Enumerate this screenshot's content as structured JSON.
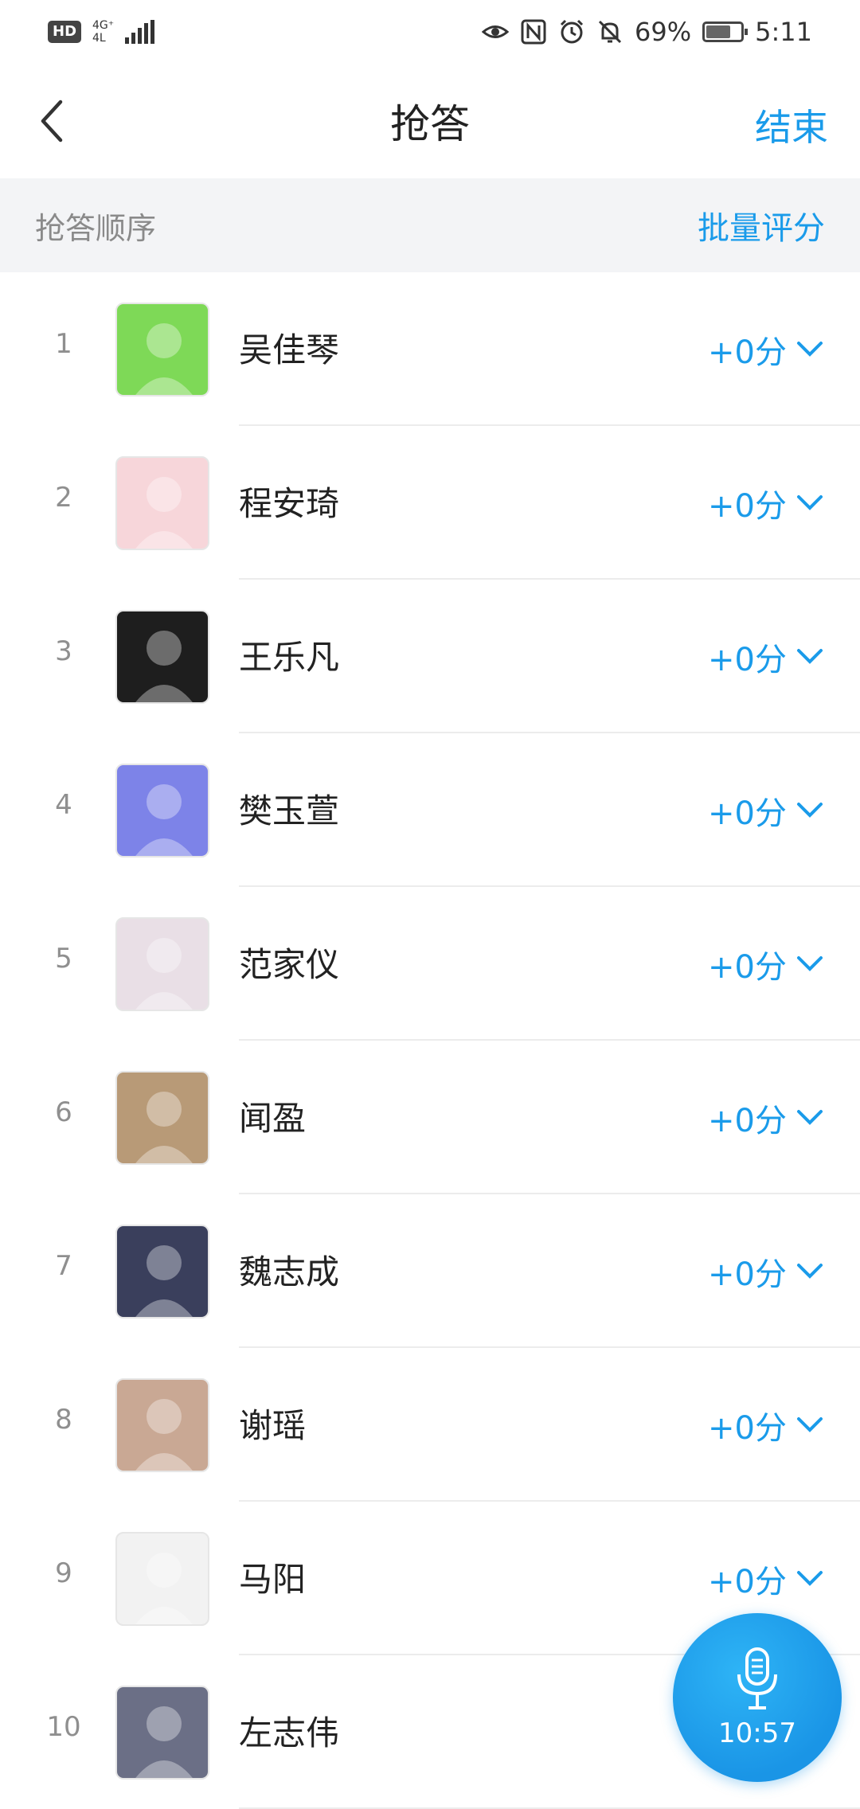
{
  "status_bar": {
    "hd": "HD",
    "network_top": "4G⁺",
    "network_bottom": "4L",
    "battery_percent": "69%",
    "time": "5:11"
  },
  "nav": {
    "title": "抢答",
    "end_label": "结束"
  },
  "subheader": {
    "order_label": "抢答顺序",
    "batch_label": "批量评分"
  },
  "students": [
    {
      "rank": "1",
      "name": "吴佳琴",
      "score": "+0分",
      "avatar_color": "#7ed957"
    },
    {
      "rank": "2",
      "name": "程安琦",
      "score": "+0分",
      "avatar_color": "#f7d6da"
    },
    {
      "rank": "3",
      "name": "王乐凡",
      "score": "+0分",
      "avatar_color": "#1e1e1e"
    },
    {
      "rank": "4",
      "name": "樊玉萱",
      "score": "+0分",
      "avatar_color": "#7d83e8"
    },
    {
      "rank": "5",
      "name": "范家仪",
      "score": "+0分",
      "avatar_color": "#e9dfe6"
    },
    {
      "rank": "6",
      "name": "闻盈",
      "score": "+0分",
      "avatar_color": "#b89a77"
    },
    {
      "rank": "7",
      "name": "魏志成",
      "score": "+0分",
      "avatar_color": "#3a3f5c"
    },
    {
      "rank": "8",
      "name": "谢瑶",
      "score": "+0分",
      "avatar_color": "#c9a894"
    },
    {
      "rank": "9",
      "name": "马阳",
      "score": "+0分",
      "avatar_color": "#f2f2f2"
    },
    {
      "rank": "10",
      "name": "左志伟",
      "score": "",
      "avatar_color": "#6b6f86"
    }
  ],
  "mic": {
    "timer": "10:57"
  },
  "colors": {
    "accent": "#1a9bea",
    "subheader_bg": "#f3f4f6"
  }
}
